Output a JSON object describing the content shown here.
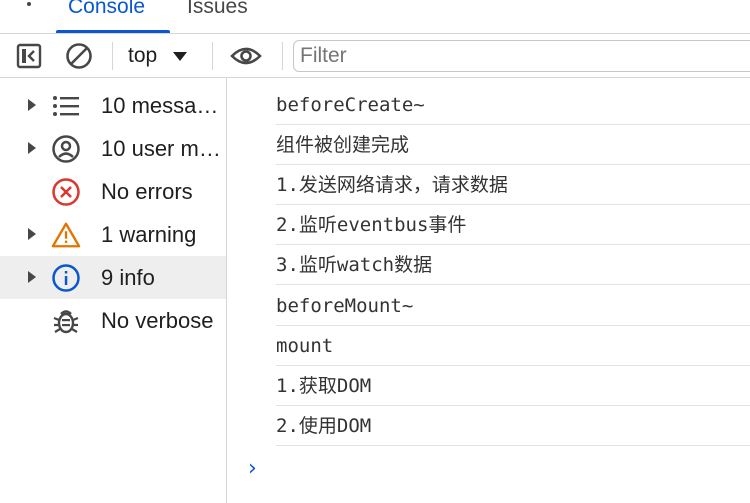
{
  "tabs": [
    {
      "label": "Console",
      "active": true
    },
    {
      "label": "Issues",
      "active": false
    }
  ],
  "toolbar": {
    "context_label": "top",
    "filter_placeholder": "Filter",
    "icons": [
      "sidebar-toggle-icon",
      "clear-console-icon",
      "eye-icon"
    ]
  },
  "sidebar": {
    "items": [
      {
        "label": "10 messages",
        "icon": "list-icon",
        "expandable": true,
        "selected": false
      },
      {
        "label": "10 user messages",
        "icon": "user-icon",
        "expandable": true,
        "selected": false
      },
      {
        "label": "No errors",
        "icon": "error-icon",
        "expandable": false,
        "selected": false
      },
      {
        "label": "1 warning",
        "icon": "warning-icon",
        "expandable": true,
        "selected": false
      },
      {
        "label": "9 info",
        "icon": "info-icon",
        "expandable": true,
        "selected": true
      },
      {
        "label": "No verbose",
        "icon": "bug-icon",
        "expandable": false,
        "selected": false
      }
    ]
  },
  "console": {
    "messages": [
      "beforeCreate~",
      "组件被创建完成",
      "1.发送网络请求，请求数据",
      "2.监听eventbus事件",
      "3.监听watch数据",
      "beforeMount~",
      "mount",
      "1.获取DOM",
      "2.使用DOM"
    ],
    "prompt_symbol": "›"
  },
  "colors": {
    "accent": "#0b57d0",
    "error": "#dc362e",
    "warning": "#e37400",
    "info": "#0b57d0",
    "selected_bg": "#eeeeee"
  }
}
